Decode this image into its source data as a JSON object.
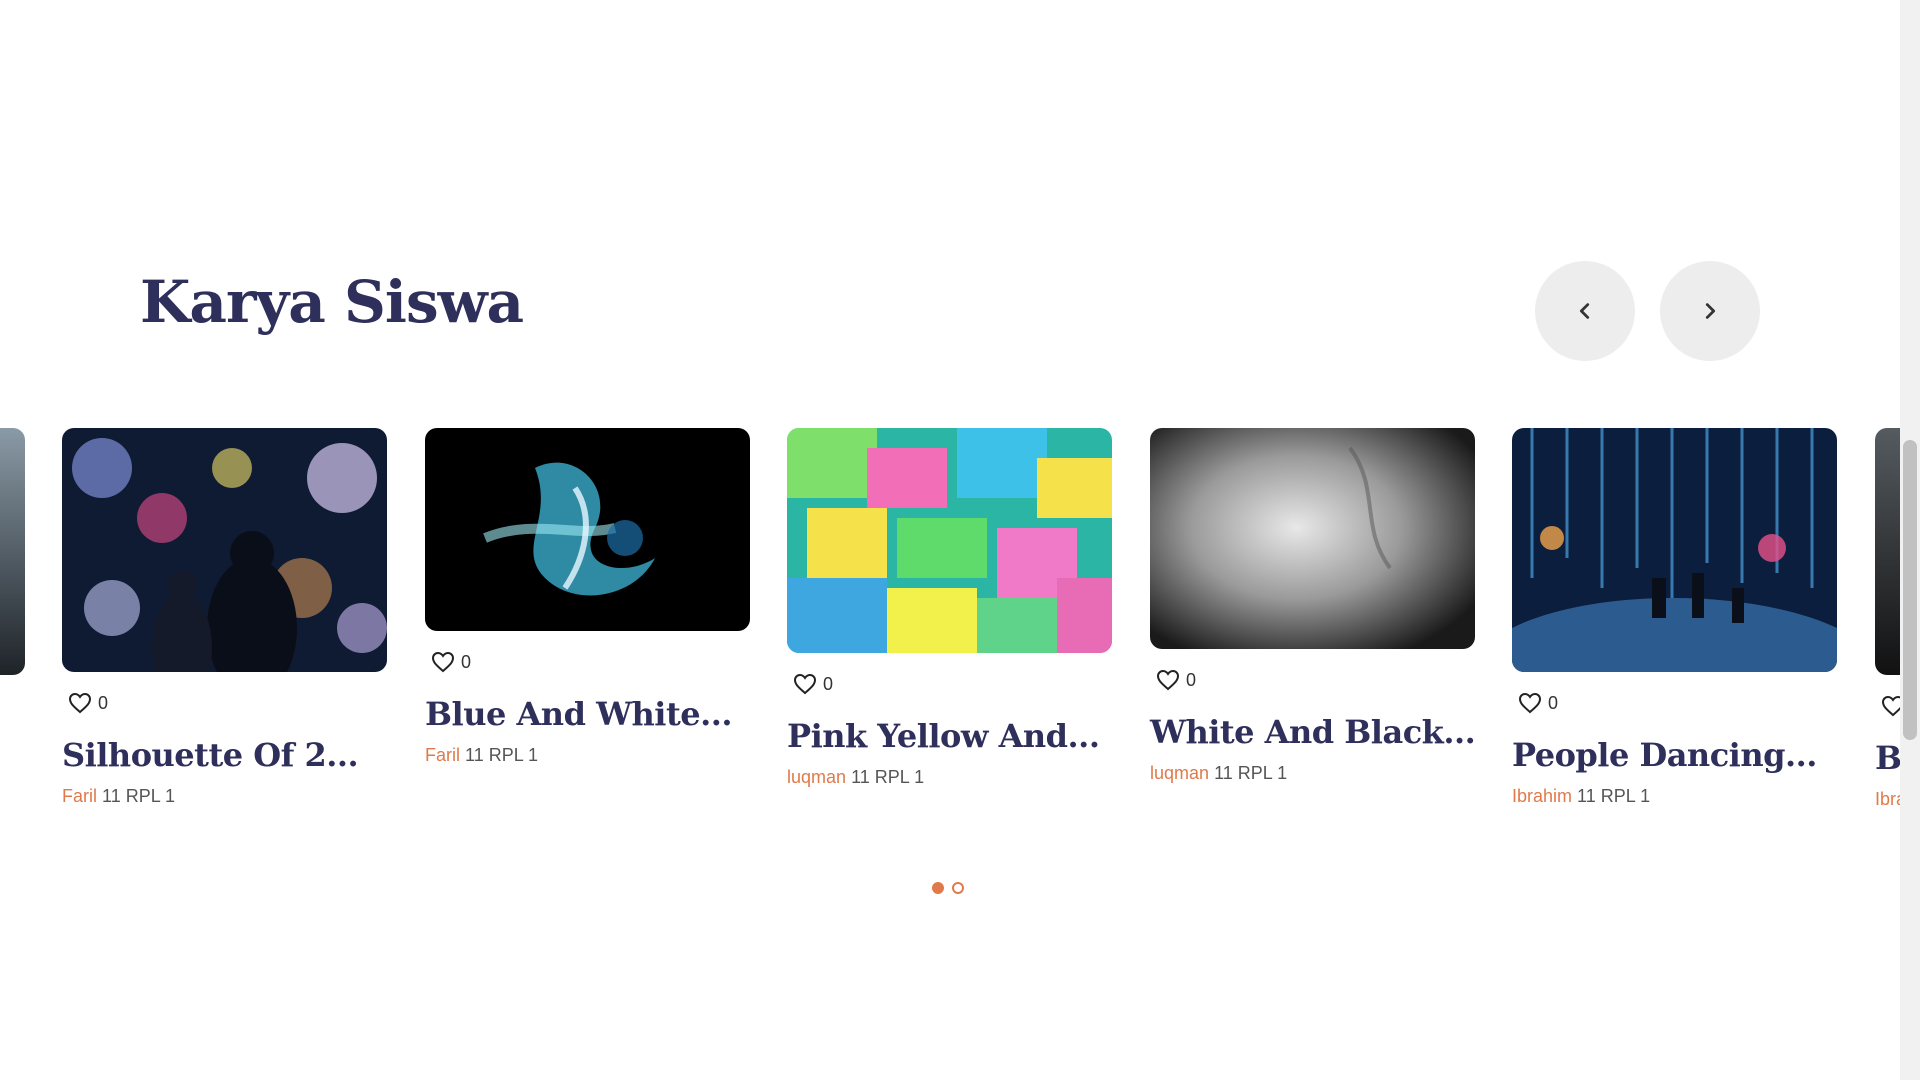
{
  "section": {
    "title": "Karya Siswa",
    "prev_icon": "chevron-left-icon",
    "next_icon": "chevron-right-icon"
  },
  "cards": [
    {
      "title": "Silhouette Of 2...",
      "author": "Faril",
      "class_label": "11 RPL 1",
      "likes": "0"
    },
    {
      "title": "Blue And White...",
      "author": "Faril",
      "class_label": "11 RPL 1",
      "likes": "0"
    },
    {
      "title": "Pink Yellow And...",
      "author": "luqman",
      "class_label": "11 RPL 1",
      "likes": "0"
    },
    {
      "title": "White And Black...",
      "author": "luqman",
      "class_label": "11 RPL 1",
      "likes": "0"
    },
    {
      "title": "People Dancing...",
      "author": "Ibrahim",
      "class_label": "11 RPL 1",
      "likes": "0"
    }
  ],
  "partial_card": {
    "title": "B",
    "author": "Ibra"
  },
  "pagination": {
    "active_index": 0,
    "count": 2
  },
  "colors": {
    "heading": "#2f2f5c",
    "accent": "#e07a4a",
    "nav_bg": "#ededed"
  }
}
